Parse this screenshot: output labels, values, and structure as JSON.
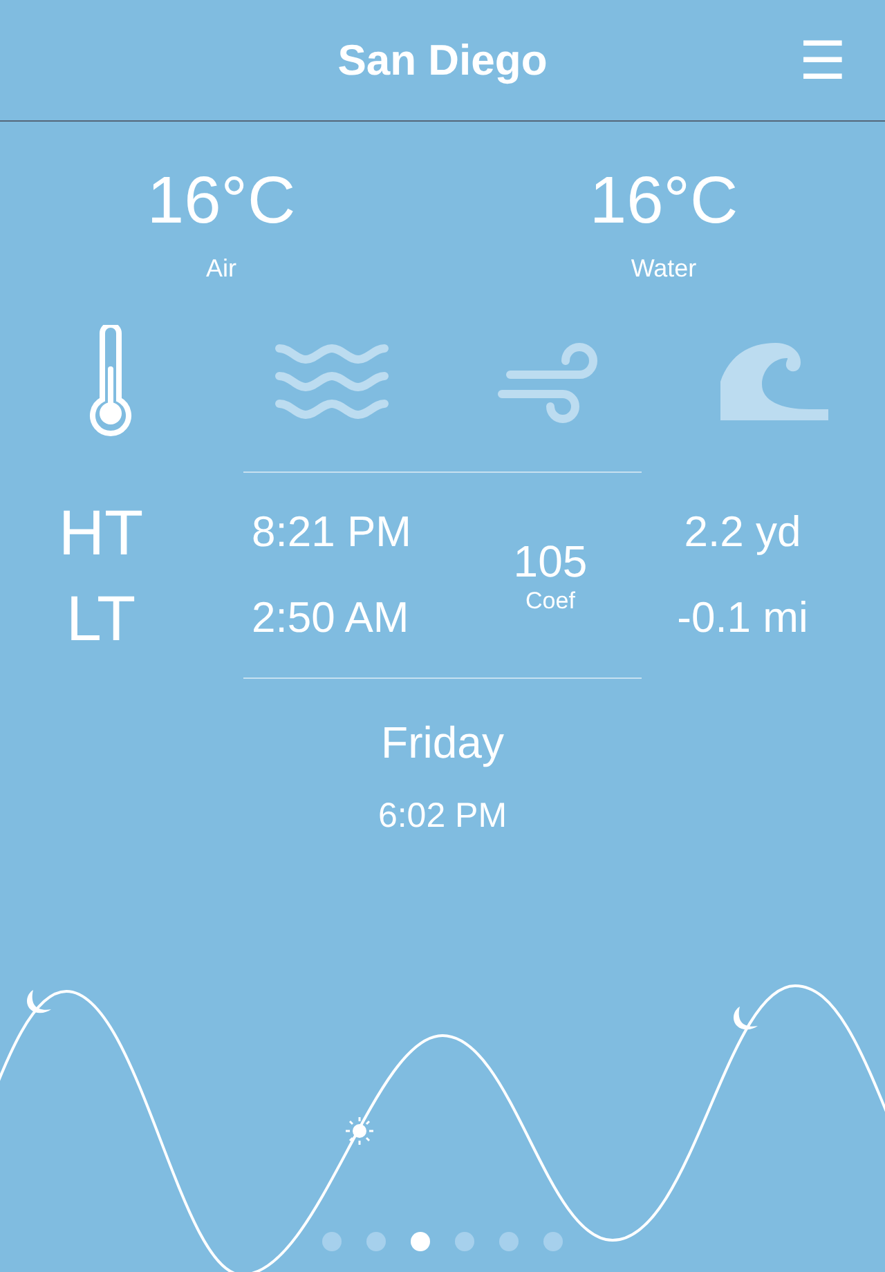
{
  "header": {
    "title": "San Diego",
    "menu_icon": "☰"
  },
  "temperatures": [
    {
      "value": "16°C",
      "label": "Air"
    },
    {
      "value": "16°C",
      "label": "Water"
    }
  ],
  "tabs": [
    {
      "kind": "thermometer",
      "selected": true
    },
    {
      "kind": "water",
      "selected": false
    },
    {
      "kind": "wind",
      "selected": false
    },
    {
      "kind": "wave",
      "selected": false
    }
  ],
  "tides": {
    "rows": [
      {
        "label": "HT",
        "time": "8:21 PM",
        "height": "2.2 yd"
      },
      {
        "label": "LT",
        "time": "2:50 AM",
        "height": "-0.1 mi"
      }
    ],
    "coef": "105",
    "coef_label": "Coef"
  },
  "day": "Friday",
  "time": "6:02 PM",
  "pages": [
    {
      "selected": false
    },
    {
      "selected": false
    },
    {
      "selected": true
    },
    {
      "selected": false
    },
    {
      "selected": false
    },
    {
      "selected": false
    }
  ]
}
